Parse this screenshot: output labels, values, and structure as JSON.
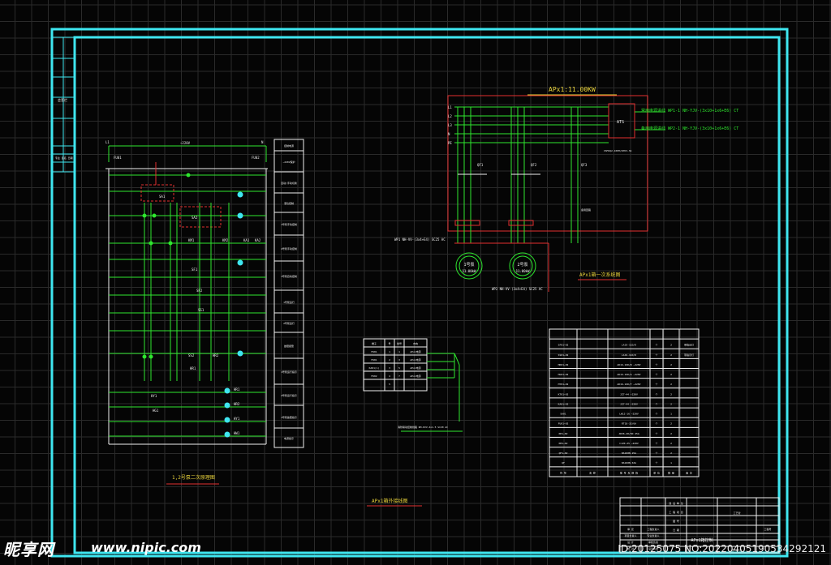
{
  "colors": {
    "background": "#050505",
    "grid": "#2a2a2a",
    "frame": "#3fe6f0",
    "line_green": "#2ee62e",
    "line_red": "#e23030",
    "text_yellow": "#e8d23a",
    "text_white": "#f0f0f0",
    "text_green": "#47ff47"
  },
  "titles": {
    "primary_diagram": "APx1:11.00KW",
    "primary_caption": "APx1箱一次系统图",
    "control_caption": "1,2号泵二次原理图",
    "terminal_caption": "APx1箱外接线图"
  },
  "primary": {
    "bus_labels": [
      "L1",
      "L2",
      "L3",
      "N",
      "PE"
    ],
    "ats_label": "ATS",
    "ats_model": "ISM1Q2-100H/4P63-3A",
    "feeder_1": "WP1-1 NH-YJV-(3x10+1x6+E6) CT",
    "feeder_2": "WP2-1 NH-YJV-(3x10+1x6+E6) CT",
    "feeder_1_prefix": "常用电源进线",
    "feeder_2_prefix": "备用电源进线",
    "branch_1": "WP1 NH-VV-(3x4+E4) SC25 AC",
    "branch_2": "WP2 NH-VV-(3x4+E4) SC25 AC",
    "motor_1": "1号泵",
    "motor_2": "2号泵",
    "motor_power": "11.00kW",
    "breaker_labels": [
      "QF1",
      "QF2",
      "QF3"
    ],
    "spare_label": "备用回路"
  },
  "control": {
    "top_labels": [
      "L1",
      "FU01",
      "N",
      "FU02"
    ],
    "bus_label": "~220V",
    "side_rows": [
      "控制电源",
      "~220V保护",
      "自动/手动切换",
      "液位控制",
      "1号泵手动控制",
      "2号泵手动控制",
      "1号泵自动控制",
      "1号泵运行",
      "2号泵运行",
      "故障报警",
      "1号泵运行指示",
      "2号泵运行指示",
      "1号泵故障指示",
      "电源指示"
    ],
    "contact_labels": [
      "SA1",
      "SA2",
      "KM1",
      "KM2",
      "KA1",
      "KA2",
      "SF1",
      "SF2",
      "SS1",
      "SS2",
      "HR1",
      "HR2",
      "HY1",
      "HG1"
    ],
    "lamp_labels": [
      "HR1",
      "HR2",
      "HY1",
      "HW1"
    ]
  },
  "terminal": {
    "headers": [
      "端子",
      "号",
      "线号",
      "去向"
    ],
    "rows": [
      [
        "FU01",
        "1",
        "1",
        "APx1电源"
      ],
      [
        "FU01",
        "2",
        "3",
        "APx1电源"
      ],
      [
        "KA01(1)",
        "3",
        "5",
        "APx1电源"
      ],
      [
        "FU02",
        "4",
        "7",
        "APx1电源"
      ],
      [
        "",
        "5",
        "",
        ""
      ]
    ],
    "cable_note": "消防联动控制线路 NH-KVV-4x1.5 SC20 AC"
  },
  "equipment": {
    "rows": [
      [
        "SF01~02",
        "LA19-11D/K",
        "个",
        "2",
        "带指示灯"
      ],
      [
        "SS01~02",
        "LA19-11D/K",
        "个",
        "2",
        "带指示灯"
      ],
      [
        "HR01~02",
        "AD16-22D/R ~220V",
        "个",
        "2",
        ""
      ],
      [
        "HG01~02",
        "AD16-22D/G ~220V",
        "个",
        "2",
        ""
      ],
      [
        "HY01~02",
        "AD16-22D/Y ~220V",
        "个",
        "2",
        ""
      ],
      [
        "KT01~02",
        "JZ7-44 ~220V",
        "个",
        "2",
        ""
      ],
      [
        "KA01~02",
        "JZ7-44 ~220V",
        "个",
        "2",
        ""
      ],
      [
        "SA01",
        "LW12-16 ~220V",
        "个",
        "1",
        ""
      ],
      [
        "FU01~02",
        "RT18-32/6A",
        "个",
        "2",
        ""
      ],
      [
        "KH1~02",
        "JR36-20/3D 25A",
        "个",
        "2",
        ""
      ],
      [
        "KM1~02",
        "CJ20-25 ~220V",
        "个",
        "2",
        ""
      ],
      [
        "QF1~02",
        "NS100N 25A",
        "个",
        "2",
        ""
      ],
      [
        "QF",
        "NS100N 63A",
        "个",
        "1",
        ""
      ]
    ],
    "footer": [
      "符 号",
      "名 称",
      "型 号 及 规 格",
      "单 位",
      "数 量",
      "备 注"
    ]
  },
  "title_block": {
    "drawing_name": "APx1箱控制",
    "cells_left": [
      "审 定",
      "项目负责人",
      "设 计",
      "校 对"
    ],
    "cells_mid": [
      "工程负责人",
      "专业负责人",
      "审核负责",
      "设计负责"
    ],
    "cells_right": [
      "建 设 单 位",
      "工 程 项 目",
      "图 号",
      "日 期"
    ],
    "sheet": "页 共 页",
    "project": "工程号",
    "proj_value": "工艺管"
  },
  "side_strip": {
    "top": "会签栏",
    "mid": "专业 签名 日期"
  },
  "watermark": {
    "logo": "昵享网",
    "url": "www.nipic.com",
    "id": "ID:20125075 NO:20220405190534292121"
  }
}
